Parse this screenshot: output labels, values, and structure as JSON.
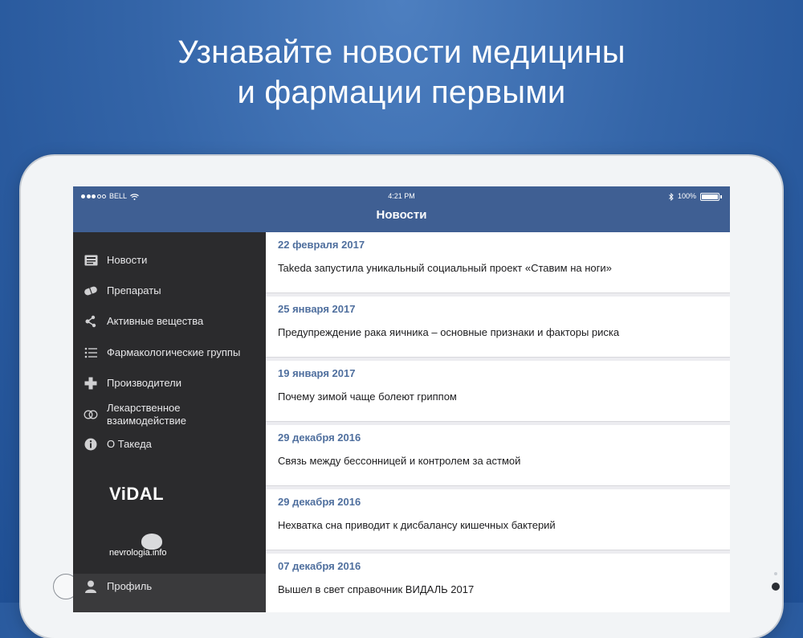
{
  "headline": {
    "line1": "Узнавайте новости медицины",
    "line2": "и фармации первыми"
  },
  "status_bar": {
    "carrier": "BELL",
    "time": "4:21 PM",
    "battery": "100%"
  },
  "nav": {
    "title": "Новости"
  },
  "sidebar": {
    "items": [
      {
        "label": "Новости",
        "icon": "news-icon"
      },
      {
        "label": "Препараты",
        "icon": "pill-icon"
      },
      {
        "label": "Активные вещества",
        "icon": "molecule-icon"
      },
      {
        "label": "Фармакологические группы",
        "icon": "list-icon"
      },
      {
        "label": "Производители",
        "icon": "plus-icon"
      },
      {
        "label": "Лекарственное взаимодействие",
        "icon": "interaction-rings-icon"
      },
      {
        "label": "О Такеда",
        "icon": "info-icon"
      }
    ],
    "vidal_logo": "ViDAL",
    "nevrologia_logo": "nevrologia.info",
    "profile_label": "Профиль"
  },
  "news": [
    {
      "date": "22 февраля 2017",
      "title": "Takeda запустила уникальный социальный проект «Ставим на ноги»"
    },
    {
      "date": "25 января 2017",
      "title": "Предупреждение рака яичника – основные признаки и факторы риска"
    },
    {
      "date": "19 января 2017",
      "title": "Почему зимой чаще болеют гриппом"
    },
    {
      "date": "29 декабря 2016",
      "title": "Связь между бессонницей и контролем за астмой"
    },
    {
      "date": "29 декабря 2016",
      "title": "Нехватка сна приводит к дисбалансу кишечных бактерий"
    },
    {
      "date": "07 декабря 2016",
      "title": "Вышел в свет справочник ВИДАЛЬ 2017"
    }
  ]
}
